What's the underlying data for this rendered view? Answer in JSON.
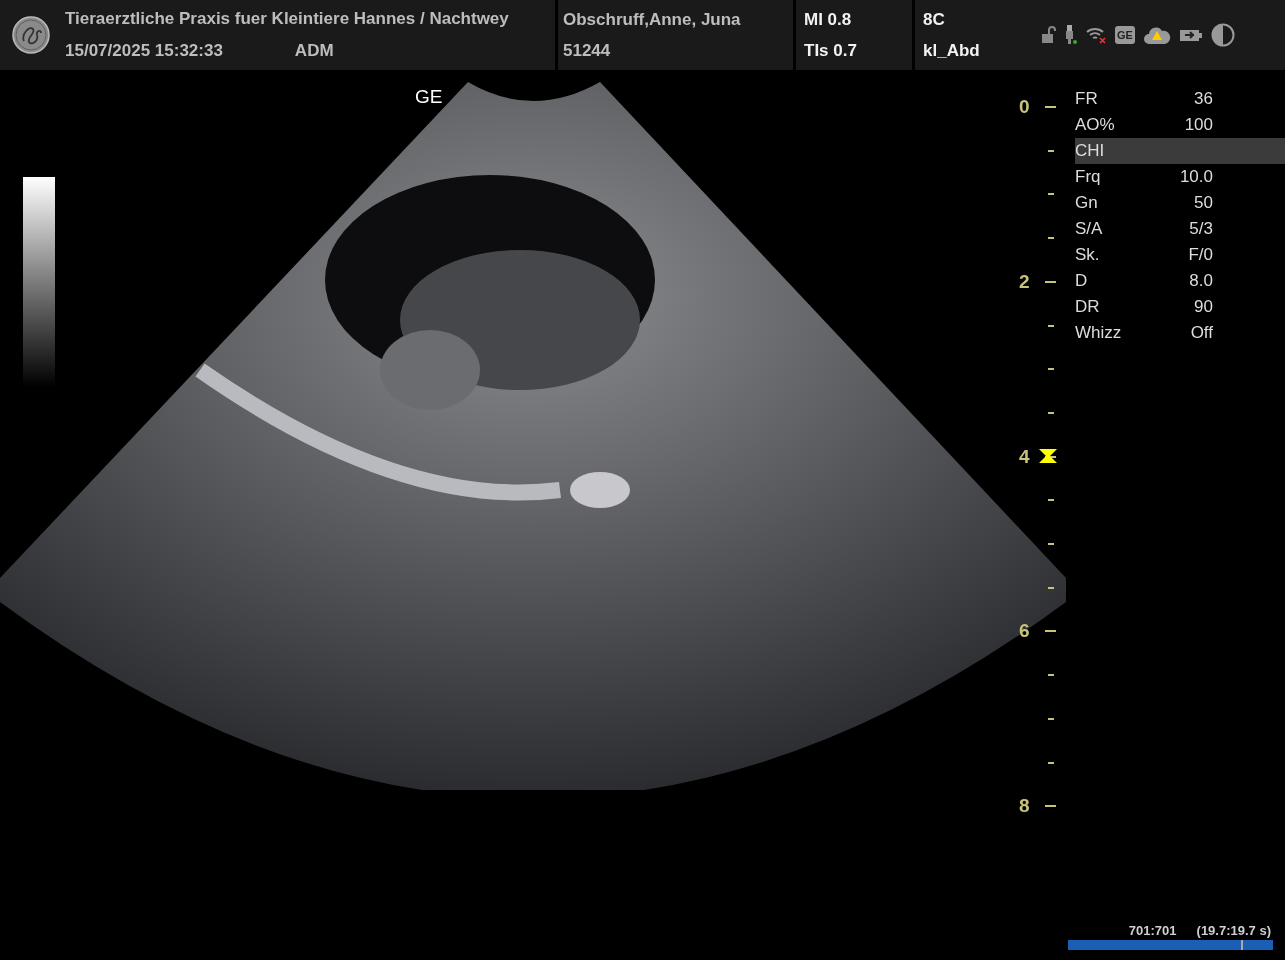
{
  "header": {
    "clinic": "Tieraerztliche Praxis fuer Kleintiere Hannes / Nachtwey",
    "datetime": "15/07/2025 15:32:33",
    "operator": "ADM",
    "patient_name": "Obschruff,Anne, Juna",
    "patient_id": "51244",
    "mi": "MI 0.8",
    "tis": "TIs 0.7",
    "probe": "8C",
    "preset": "kl_Abd",
    "service_badge": "GE"
  },
  "image": {
    "label": "GE"
  },
  "depth_scale": {
    "labels": [
      "0",
      "2",
      "4",
      "6",
      "8"
    ]
  },
  "parameters": [
    {
      "name": "FR",
      "value": "36",
      "selected": false
    },
    {
      "name": "AO%",
      "value": "100",
      "selected": false
    },
    {
      "name": "CHI",
      "selected": true
    },
    {
      "name": "Frq",
      "value": "10.0",
      "selected": false
    },
    {
      "name": "Gn",
      "value": "50",
      "selected": false
    },
    {
      "name": "S/A",
      "value": "5/3",
      "selected": false
    },
    {
      "name": "Sk.",
      "value": "F/0",
      "selected": false
    },
    {
      "name": "D",
      "value": "8.0",
      "selected": false
    },
    {
      "name": "DR",
      "value": "90",
      "selected": false
    },
    {
      "name": "Whizz",
      "value": "Off",
      "selected": false
    }
  ],
  "cine": {
    "frames": "701:701",
    "time": "(19.7:19.7 s)",
    "level": 1
  }
}
